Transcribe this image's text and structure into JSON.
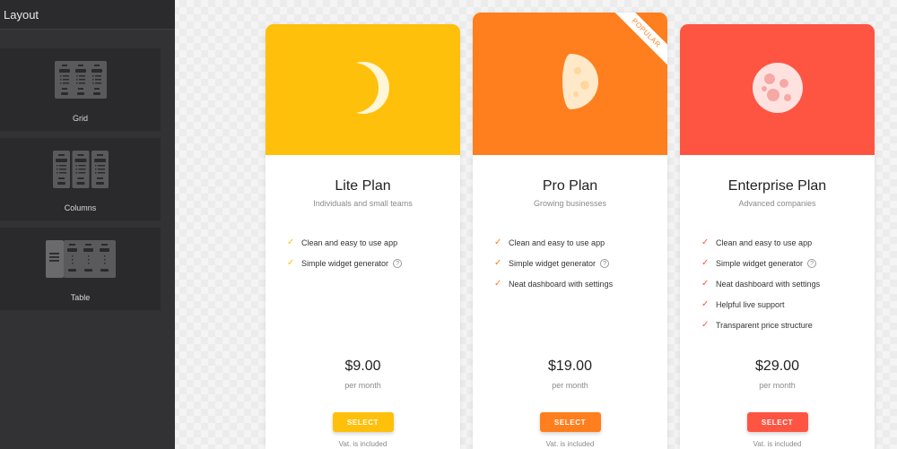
{
  "sidebar": {
    "title": "Layout",
    "items": [
      {
        "label": "Grid",
        "icon": "grid-layout-icon"
      },
      {
        "label": "Columns",
        "icon": "columns-layout-icon"
      },
      {
        "label": "Table",
        "icon": "table-layout-icon"
      }
    ]
  },
  "plans": [
    {
      "name": "Lite Plan",
      "subtitle": "Individuals and small teams",
      "icon": "crescent-moon-icon",
      "color": "#ffc00b",
      "features": [
        "Clean and easy to use app",
        "Simple widget generator"
      ],
      "price": "$9.00",
      "period": "per month",
      "button": "SELECT",
      "vat": "Vat. is included"
    },
    {
      "name": "Pro Plan",
      "subtitle": "Growing businesses",
      "icon": "half-moon-icon",
      "color": "#ff7e1d",
      "badge": "POPULAR",
      "features": [
        "Clean and easy to use app",
        "Simple widget generator",
        "Neat dashboard with settings"
      ],
      "price": "$19.00",
      "period": "per month",
      "button": "SELECT",
      "vat": "Vat. is included"
    },
    {
      "name": "Enterprise Plan",
      "subtitle": "Advanced companies",
      "icon": "full-moon-icon",
      "color": "#fe5543",
      "features": [
        "Clean and easy to use app",
        "Simple widget generator",
        "Neat dashboard with settings",
        "Helpful live support",
        "Transparent price structure"
      ],
      "price": "$29.00",
      "period": "per month",
      "button": "SELECT",
      "vat": "Vat. is included"
    }
  ],
  "help_glyph": "?",
  "check_glyph": "✓"
}
